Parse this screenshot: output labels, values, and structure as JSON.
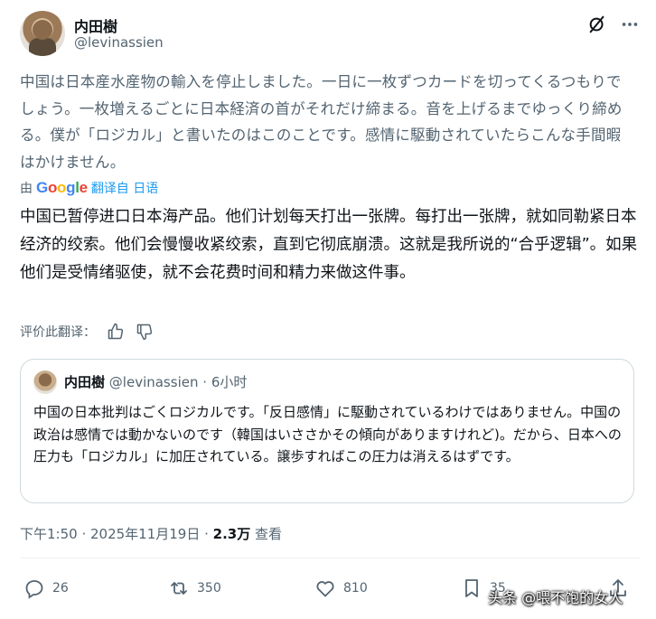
{
  "author": {
    "name": "内田樹",
    "handle": "@levinassien"
  },
  "tweet": {
    "text": "中国は日本産水産物の輸入を停止しました。一日に一枚ずつカードを切ってくるつもりでしょう。一枚増えるごとに日本経済の首がそれだけ締まる。音を上げるまでゆっくり締める。僕が「ロジカル」と書いたのはこのことです。感情に駆動されていたらこんな手間暇はかけません。"
  },
  "translation": {
    "by_prefix": "由",
    "google": "Google",
    "from_label": "翻译自 日语",
    "text": "中国已暂停进口日本海产品。他们计划每天打出一张牌。每打出一张牌，就如同勒紧日本经济的绞索。他们会慢慢收紧绞索，直到它彻底崩溃。这就是我所说的“合乎逻辑”。如果他们是受情绪驱使，就不会花费时间和精力来做这件事。",
    "rate_label": "评价此翻译："
  },
  "quote": {
    "name": "内田樹",
    "handle": "@levinassien",
    "separator": "·",
    "time": "6小时",
    "text": "中国の日本批判はごくロジカルです。「反日感情」に駆動されているわけではありません。中国の政治は感情では動かないのです（韓国はいささかその傾向がありますけれど)。だから、日本への圧力も「ロジカル」に加圧されている。譲歩すればこの圧力は消えるはずです。"
  },
  "meta": {
    "timestamp": "下午1:50 · 2025年11月19日 ·",
    "views": "2.3万",
    "views_label": "查看"
  },
  "actions": {
    "replies": "26",
    "reposts": "350",
    "likes": "810",
    "bookmarks": "35"
  },
  "watermark": "头条 @喂不饱的女人",
  "colors": {
    "text": "#0f1419",
    "secondary": "#536471",
    "link": "#1d9bf0",
    "border": "#cfd9de"
  }
}
